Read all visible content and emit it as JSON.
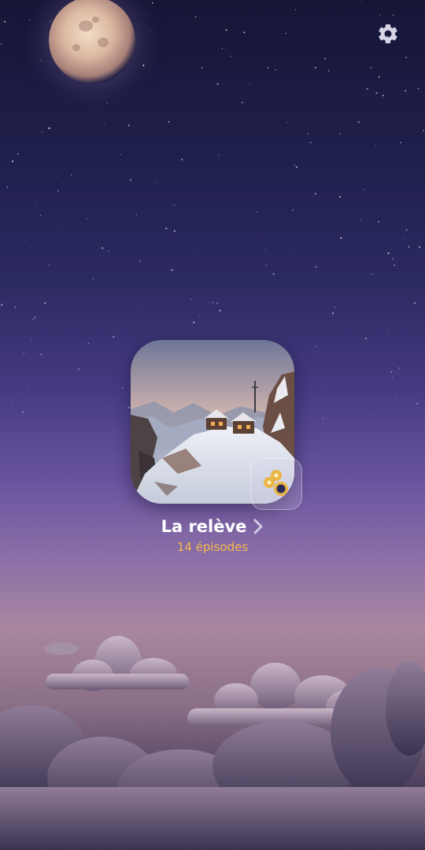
{
  "header": {
    "settings_icon": "gear-icon"
  },
  "background": {
    "moon_icon": "moon-icon"
  },
  "story": {
    "title": "La relève",
    "episodes": "14 épisodes",
    "badge_icon": "record-discs-icon",
    "chevron_icon": "chevron-right-icon",
    "accent_color": "#f6b94b"
  }
}
